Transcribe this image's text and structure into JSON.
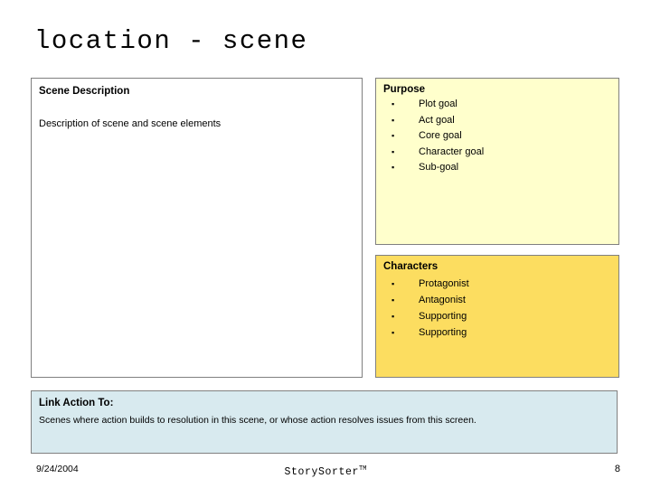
{
  "slide": {
    "title": "location - scene"
  },
  "scene_description": {
    "heading": "Scene Description",
    "body": "Description of scene and scene elements",
    "background_color": "#ffffff",
    "border_color": "#808080"
  },
  "purpose": {
    "heading": "Purpose",
    "bullet_glyph": "▪",
    "items": [
      "Plot goal",
      "Act goal",
      "Core goal",
      "Character goal",
      "Sub-goal"
    ],
    "background_color": "#ffffcc",
    "border_color": "#808080"
  },
  "characters": {
    "heading": "Characters",
    "bullet_glyph": "▪",
    "items": [
      "Protagonist",
      "Antagonist",
      "Supporting",
      "Supporting"
    ],
    "background_color": "#fcdd60",
    "border_color": "#808080"
  },
  "link_action": {
    "heading": "Link Action To:",
    "body": "Scenes where action builds to resolution in this scene, or whose action resolves issues from this screen.",
    "background_color": "#d8eaef",
    "border_color": "#808080"
  },
  "footer": {
    "date": "9/24/2004",
    "brand": "StorySorter",
    "brand_mark": "TM",
    "page_number": "8"
  }
}
